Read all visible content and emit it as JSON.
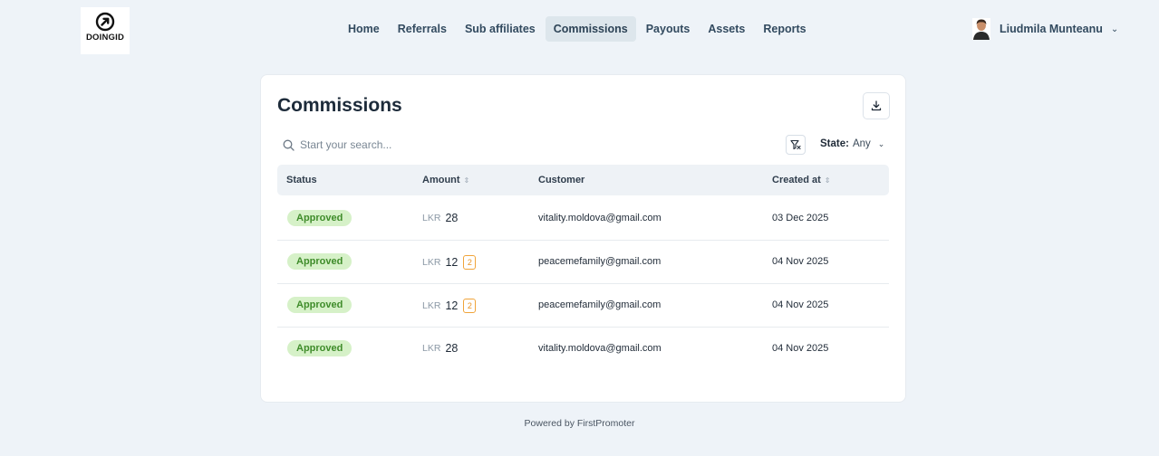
{
  "brand": {
    "logo_text": "DOINGID"
  },
  "nav": {
    "items": [
      {
        "label": "Home",
        "active": false
      },
      {
        "label": "Referrals",
        "active": false
      },
      {
        "label": "Sub affiliates",
        "active": false
      },
      {
        "label": "Commissions",
        "active": true
      },
      {
        "label": "Payouts",
        "active": false
      },
      {
        "label": "Assets",
        "active": false
      },
      {
        "label": "Reports",
        "active": false
      }
    ]
  },
  "user": {
    "name": "Liudmila Munteanu"
  },
  "page": {
    "title": "Commissions",
    "search_placeholder": "Start your search...",
    "state_filter": {
      "label": "State:",
      "value": "Any"
    }
  },
  "table": {
    "columns": {
      "status": "Status",
      "amount": "Amount",
      "customer": "Customer",
      "created": "Created at"
    },
    "rows": [
      {
        "status": "Approved",
        "currency": "LKR",
        "amount": "28",
        "count": "",
        "customer": "vitality.moldova@gmail.com",
        "created": "03 Dec 2025"
      },
      {
        "status": "Approved",
        "currency": "LKR",
        "amount": "12",
        "count": "2",
        "customer": "peacemefamily@gmail.com",
        "created": "04 Nov 2025"
      },
      {
        "status": "Approved",
        "currency": "LKR",
        "amount": "12",
        "count": "2",
        "customer": "peacemefamily@gmail.com",
        "created": "04 Nov 2025"
      },
      {
        "status": "Approved",
        "currency": "LKR",
        "amount": "28",
        "count": "",
        "customer": "vitality.moldova@gmail.com",
        "created": "04 Nov 2025"
      }
    ]
  },
  "footer": {
    "text": "Powered by FirstPromoter"
  },
  "colors": {
    "background": "#eef3f8",
    "approved_bg": "#d6f1c8",
    "approved_text": "#3f8c2a",
    "count_badge": "#f0a43a"
  }
}
